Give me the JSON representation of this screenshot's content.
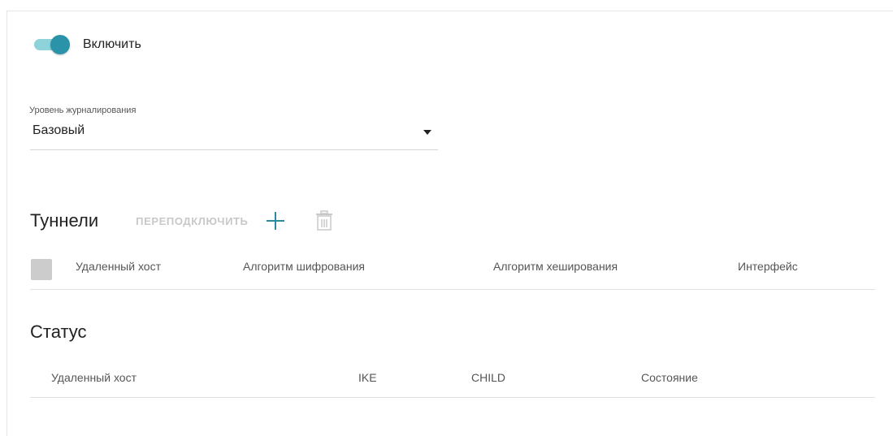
{
  "enable": {
    "label": "Включить",
    "state": "on",
    "track_color": "#8fd3da",
    "knob_color": "#2a93a9"
  },
  "log_level": {
    "caption": "Уровень журналирования",
    "value": "Базовый"
  },
  "tunnels": {
    "title": "Туннели",
    "reconnect_label": "ПЕРЕПОДКЛЮЧИТЬ",
    "add_icon": "plus-icon",
    "delete_icon": "trash-icon",
    "accent_color": "#2a8aa1",
    "columns": [
      "Удаленный хост",
      "Алгоритм шифрования",
      "Алгоритм хеширования",
      "Интерфейс"
    ]
  },
  "status": {
    "title": "Статус",
    "columns": [
      "Удаленный хост",
      "IKE",
      "CHILD",
      "Состояние"
    ]
  }
}
